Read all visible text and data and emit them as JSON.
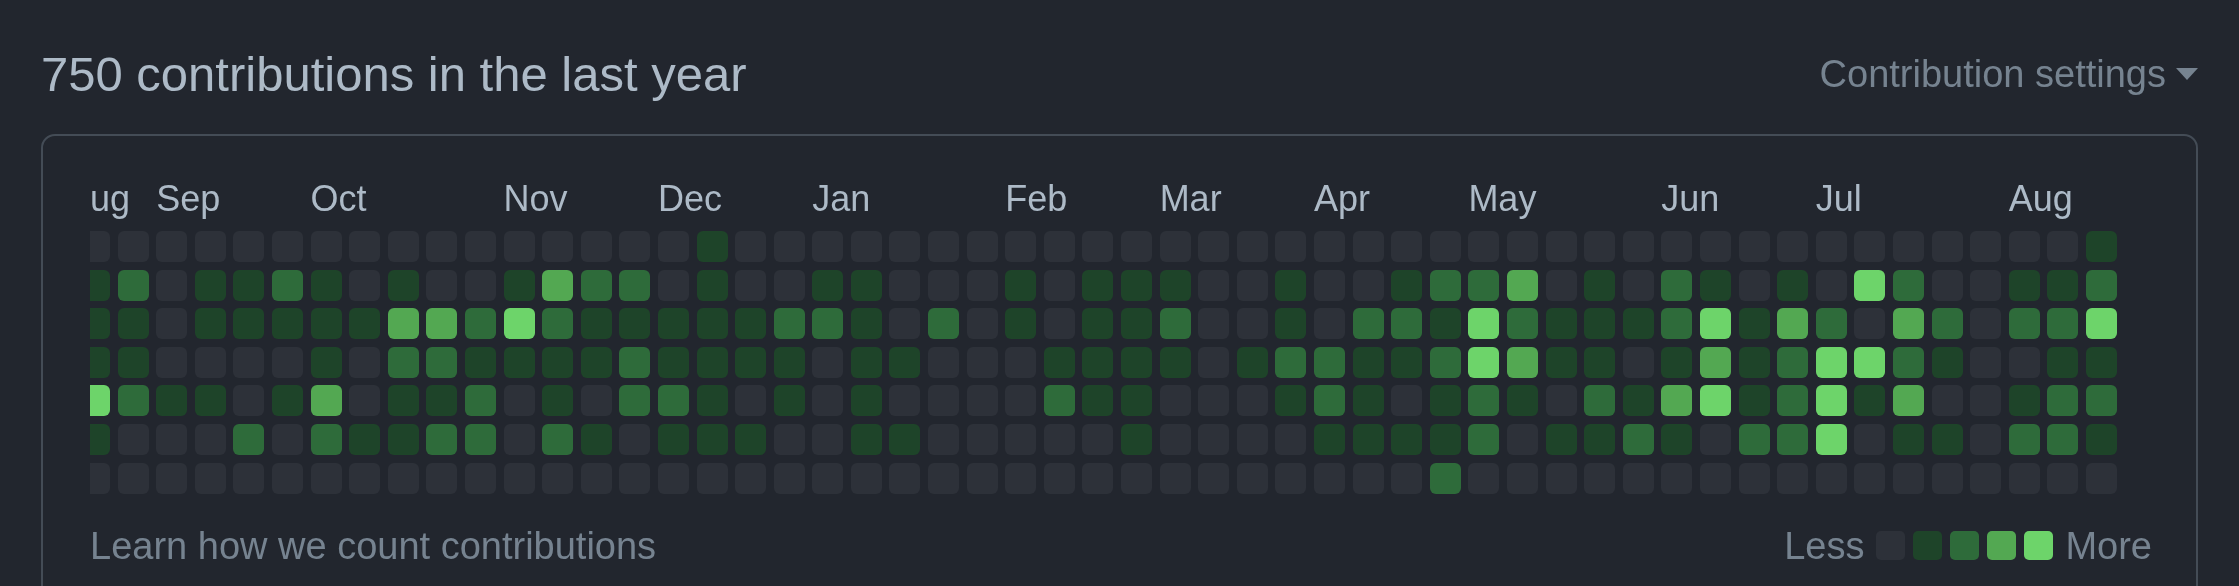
{
  "title": "750 contributions in the last year",
  "settings": {
    "label": "Contribution settings"
  },
  "weeks": [
    {
      "month": "ug",
      "days": [
        {
          "color": "#2d3139"
        },
        {
          "color": "#1e4429"
        },
        {
          "color": "#1e4429"
        },
        {
          "color": "#1e4429"
        },
        {
          "color": "#6dd46a"
        },
        {
          "color": "#1e4429"
        },
        {
          "color": "#2d3139"
        }
      ]
    },
    {
      "days": [
        {
          "color": "#2d3139"
        },
        {
          "color": "#2e6b3a"
        },
        {
          "color": "#1e4429"
        },
        {
          "color": "#1e4429"
        },
        {
          "color": "#2e6b3a"
        },
        {
          "color": "#2d3139"
        },
        {
          "color": "#2d3139"
        }
      ]
    },
    {
      "month": "Sep",
      "days": [
        {
          "color": "#2d3139"
        },
        {
          "color": "#2d3139"
        },
        {
          "color": "#2d3139"
        },
        {
          "color": "#2d3139"
        },
        {
          "color": "#1e4429"
        },
        {
          "color": "#2d3139"
        },
        {
          "color": "#2d3139"
        }
      ]
    },
    {
      "days": [
        {
          "color": "#2d3139"
        },
        {
          "color": "#1e4429"
        },
        {
          "color": "#1e4429"
        },
        {
          "color": "#2d3139"
        },
        {
          "color": "#1e4429"
        },
        {
          "color": "#2d3139"
        },
        {
          "color": "#2d3139"
        }
      ]
    },
    {
      "days": [
        {
          "color": "#2d3139"
        },
        {
          "color": "#1e4429"
        },
        {
          "color": "#1e4429"
        },
        {
          "color": "#2d3139"
        },
        {
          "color": "#2d3139"
        },
        {
          "color": "#2e6b3a"
        },
        {
          "color": "#2d3139"
        }
      ]
    },
    {
      "days": [
        {
          "color": "#2d3139"
        },
        {
          "color": "#2e6b3a"
        },
        {
          "color": "#1e4429"
        },
        {
          "color": "#2d3139"
        },
        {
          "color": "#1e4429"
        },
        {
          "color": "#2d3139"
        },
        {
          "color": "#2d3139"
        }
      ]
    },
    {
      "month": "Oct",
      "days": [
        {
          "color": "#2d3139"
        },
        {
          "color": "#1e4429"
        },
        {
          "color": "#1e4429"
        },
        {
          "color": "#1e4429"
        },
        {
          "color": "#53a852"
        },
        {
          "color": "#2e6b3a"
        },
        {
          "color": "#2d3139"
        }
      ]
    },
    {
      "days": [
        {
          "color": "#2d3139"
        },
        {
          "color": "#2d3139"
        },
        {
          "color": "#1e4429"
        },
        {
          "color": "#2d3139"
        },
        {
          "color": "#2d3139"
        },
        {
          "color": "#1e4429"
        },
        {
          "color": "#2d3139"
        }
      ]
    },
    {
      "days": [
        {
          "color": "#2d3139"
        },
        {
          "color": "#1e4429"
        },
        {
          "color": "#53a852"
        },
        {
          "color": "#2e6b3a"
        },
        {
          "color": "#1e4429"
        },
        {
          "color": "#1e4429"
        },
        {
          "color": "#2d3139"
        }
      ]
    },
    {
      "days": [
        {
          "color": "#2d3139"
        },
        {
          "color": "#2d3139"
        },
        {
          "color": "#53a852"
        },
        {
          "color": "#2e6b3a"
        },
        {
          "color": "#1e4429"
        },
        {
          "color": "#2e6b3a"
        },
        {
          "color": "#2d3139"
        }
      ]
    },
    {
      "days": [
        {
          "color": "#2d3139"
        },
        {
          "color": "#2d3139"
        },
        {
          "color": "#2e6b3a"
        },
        {
          "color": "#1e4429"
        },
        {
          "color": "#2e6b3a"
        },
        {
          "color": "#2e6b3a"
        },
        {
          "color": "#2d3139"
        }
      ]
    },
    {
      "month": "Nov",
      "days": [
        {
          "color": "#2d3139"
        },
        {
          "color": "#1e4429"
        },
        {
          "color": "#6dd46a"
        },
        {
          "color": "#1e4429"
        },
        {
          "color": "#2d3139"
        },
        {
          "color": "#2d3139"
        },
        {
          "color": "#2d3139"
        }
      ]
    },
    {
      "days": [
        {
          "color": "#2d3139"
        },
        {
          "color": "#53a852"
        },
        {
          "color": "#2e6b3a"
        },
        {
          "color": "#1e4429"
        },
        {
          "color": "#1e4429"
        },
        {
          "color": "#2e6b3a"
        },
        {
          "color": "#2d3139"
        }
      ]
    },
    {
      "days": [
        {
          "color": "#2d3139"
        },
        {
          "color": "#2e6b3a"
        },
        {
          "color": "#1e4429"
        },
        {
          "color": "#1e4429"
        },
        {
          "color": "#2d3139"
        },
        {
          "color": "#1e4429"
        },
        {
          "color": "#2d3139"
        }
      ]
    },
    {
      "days": [
        {
          "color": "#2d3139"
        },
        {
          "color": "#2e6b3a"
        },
        {
          "color": "#1e4429"
        },
        {
          "color": "#2e6b3a"
        },
        {
          "color": "#2e6b3a"
        },
        {
          "color": "#2d3139"
        },
        {
          "color": "#2d3139"
        }
      ]
    },
    {
      "month": "Dec",
      "days": [
        {
          "color": "#2d3139"
        },
        {
          "color": "#2d3139"
        },
        {
          "color": "#1e4429"
        },
        {
          "color": "#1e4429"
        },
        {
          "color": "#2e6b3a"
        },
        {
          "color": "#1e4429"
        },
        {
          "color": "#2d3139"
        }
      ]
    },
    {
      "days": [
        {
          "color": "#1e4429"
        },
        {
          "color": "#1e4429"
        },
        {
          "color": "#1e4429"
        },
        {
          "color": "#1e4429"
        },
        {
          "color": "#1e4429"
        },
        {
          "color": "#1e4429"
        },
        {
          "color": "#2d3139"
        }
      ]
    },
    {
      "days": [
        {
          "color": "#2d3139"
        },
        {
          "color": "#2d3139"
        },
        {
          "color": "#1e4429"
        },
        {
          "color": "#1e4429"
        },
        {
          "color": "#2d3139"
        },
        {
          "color": "#1e4429"
        },
        {
          "color": "#2d3139"
        }
      ]
    },
    {
      "days": [
        {
          "color": "#2d3139"
        },
        {
          "color": "#2d3139"
        },
        {
          "color": "#2e6b3a"
        },
        {
          "color": "#1e4429"
        },
        {
          "color": "#1e4429"
        },
        {
          "color": "#2d3139"
        },
        {
          "color": "#2d3139"
        }
      ]
    },
    {
      "month": "Jan",
      "days": [
        {
          "color": "#2d3139"
        },
        {
          "color": "#1e4429"
        },
        {
          "color": "#2e6b3a"
        },
        {
          "color": "#2d3139"
        },
        {
          "color": "#2d3139"
        },
        {
          "color": "#2d3139"
        },
        {
          "color": "#2d3139"
        }
      ]
    },
    {
      "days": [
        {
          "color": "#2d3139"
        },
        {
          "color": "#1e4429"
        },
        {
          "color": "#1e4429"
        },
        {
          "color": "#1e4429"
        },
        {
          "color": "#1e4429"
        },
        {
          "color": "#1e4429"
        },
        {
          "color": "#2d3139"
        }
      ]
    },
    {
      "days": [
        {
          "color": "#2d3139"
        },
        {
          "color": "#2d3139"
        },
        {
          "color": "#2d3139"
        },
        {
          "color": "#1e4429"
        },
        {
          "color": "#2d3139"
        },
        {
          "color": "#1e4429"
        },
        {
          "color": "#2d3139"
        }
      ]
    },
    {
      "days": [
        {
          "color": "#2d3139"
        },
        {
          "color": "#2d3139"
        },
        {
          "color": "#2e6b3a"
        },
        {
          "color": "#2d3139"
        },
        {
          "color": "#2d3139"
        },
        {
          "color": "#2d3139"
        },
        {
          "color": "#2d3139"
        }
      ]
    },
    {
      "days": [
        {
          "color": "#2d3139"
        },
        {
          "color": "#2d3139"
        },
        {
          "color": "#2d3139"
        },
        {
          "color": "#2d3139"
        },
        {
          "color": "#2d3139"
        },
        {
          "color": "#2d3139"
        },
        {
          "color": "#2d3139"
        }
      ]
    },
    {
      "month": "Feb",
      "days": [
        {
          "color": "#2d3139"
        },
        {
          "color": "#1e4429"
        },
        {
          "color": "#1e4429"
        },
        {
          "color": "#2d3139"
        },
        {
          "color": "#2d3139"
        },
        {
          "color": "#2d3139"
        },
        {
          "color": "#2d3139"
        }
      ]
    },
    {
      "days": [
        {
          "color": "#2d3139"
        },
        {
          "color": "#2d3139"
        },
        {
          "color": "#2d3139"
        },
        {
          "color": "#1e4429"
        },
        {
          "color": "#2e6b3a"
        },
        {
          "color": "#2d3139"
        },
        {
          "color": "#2d3139"
        }
      ]
    },
    {
      "days": [
        {
          "color": "#2d3139"
        },
        {
          "color": "#1e4429"
        },
        {
          "color": "#1e4429"
        },
        {
          "color": "#1e4429"
        },
        {
          "color": "#1e4429"
        },
        {
          "color": "#2d3139"
        },
        {
          "color": "#2d3139"
        }
      ]
    },
    {
      "days": [
        {
          "color": "#2d3139"
        },
        {
          "color": "#1e4429"
        },
        {
          "color": "#1e4429"
        },
        {
          "color": "#1e4429"
        },
        {
          "color": "#1e4429"
        },
        {
          "color": "#1e4429"
        },
        {
          "color": "#2d3139"
        }
      ]
    },
    {
      "month": "Mar",
      "days": [
        {
          "color": "#2d3139"
        },
        {
          "color": "#1e4429"
        },
        {
          "color": "#2e6b3a"
        },
        {
          "color": "#1e4429"
        },
        {
          "color": "#2d3139"
        },
        {
          "color": "#2d3139"
        },
        {
          "color": "#2d3139"
        }
      ]
    },
    {
      "days": [
        {
          "color": "#2d3139"
        },
        {
          "color": "#2d3139"
        },
        {
          "color": "#2d3139"
        },
        {
          "color": "#2d3139"
        },
        {
          "color": "#2d3139"
        },
        {
          "color": "#2d3139"
        },
        {
          "color": "#2d3139"
        }
      ]
    },
    {
      "days": [
        {
          "color": "#2d3139"
        },
        {
          "color": "#2d3139"
        },
        {
          "color": "#2d3139"
        },
        {
          "color": "#1e4429"
        },
        {
          "color": "#2d3139"
        },
        {
          "color": "#2d3139"
        },
        {
          "color": "#2d3139"
        }
      ]
    },
    {
      "days": [
        {
          "color": "#2d3139"
        },
        {
          "color": "#1e4429"
        },
        {
          "color": "#1e4429"
        },
        {
          "color": "#2e6b3a"
        },
        {
          "color": "#1e4429"
        },
        {
          "color": "#2d3139"
        },
        {
          "color": "#2d3139"
        }
      ]
    },
    {
      "month": "Apr",
      "days": [
        {
          "color": "#2d3139"
        },
        {
          "color": "#2d3139"
        },
        {
          "color": "#2d3139"
        },
        {
          "color": "#2e6b3a"
        },
        {
          "color": "#2e6b3a"
        },
        {
          "color": "#1e4429"
        },
        {
          "color": "#2d3139"
        }
      ]
    },
    {
      "days": [
        {
          "color": "#2d3139"
        },
        {
          "color": "#2d3139"
        },
        {
          "color": "#2e6b3a"
        },
        {
          "color": "#1e4429"
        },
        {
          "color": "#1e4429"
        },
        {
          "color": "#1e4429"
        },
        {
          "color": "#2d3139"
        }
      ]
    },
    {
      "days": [
        {
          "color": "#2d3139"
        },
        {
          "color": "#1e4429"
        },
        {
          "color": "#2e6b3a"
        },
        {
          "color": "#1e4429"
        },
        {
          "color": "#2d3139"
        },
        {
          "color": "#1e4429"
        },
        {
          "color": "#2d3139"
        }
      ]
    },
    {
      "days": [
        {
          "color": "#2d3139"
        },
        {
          "color": "#2e6b3a"
        },
        {
          "color": "#1e4429"
        },
        {
          "color": "#2e6b3a"
        },
        {
          "color": "#1e4429"
        },
        {
          "color": "#1e4429"
        },
        {
          "color": "#2e6b3a"
        }
      ]
    },
    {
      "month": "May",
      "days": [
        {
          "color": "#2d3139"
        },
        {
          "color": "#2e6b3a"
        },
        {
          "color": "#6dd46a"
        },
        {
          "color": "#6dd46a"
        },
        {
          "color": "#2e6b3a"
        },
        {
          "color": "#2e6b3a"
        },
        {
          "color": "#2d3139"
        }
      ]
    },
    {
      "days": [
        {
          "color": "#2d3139"
        },
        {
          "color": "#53a852"
        },
        {
          "color": "#2e6b3a"
        },
        {
          "color": "#53a852"
        },
        {
          "color": "#1e4429"
        },
        {
          "color": "#2d3139"
        },
        {
          "color": "#2d3139"
        }
      ]
    },
    {
      "days": [
        {
          "color": "#2d3139"
        },
        {
          "color": "#2d3139"
        },
        {
          "color": "#1e4429"
        },
        {
          "color": "#1e4429"
        },
        {
          "color": "#2d3139"
        },
        {
          "color": "#1e4429"
        },
        {
          "color": "#2d3139"
        }
      ]
    },
    {
      "days": [
        {
          "color": "#2d3139"
        },
        {
          "color": "#1e4429"
        },
        {
          "color": "#1e4429"
        },
        {
          "color": "#1e4429"
        },
        {
          "color": "#2e6b3a"
        },
        {
          "color": "#1e4429"
        },
        {
          "color": "#2d3139"
        }
      ]
    },
    {
      "days": [
        {
          "color": "#2d3139"
        },
        {
          "color": "#2d3139"
        },
        {
          "color": "#1e4429"
        },
        {
          "color": "#2d3139"
        },
        {
          "color": "#1e4429"
        },
        {
          "color": "#2e6b3a"
        },
        {
          "color": "#2d3139"
        }
      ]
    },
    {
      "month": "Jun",
      "days": [
        {
          "color": "#2d3139"
        },
        {
          "color": "#2e6b3a"
        },
        {
          "color": "#2e6b3a"
        },
        {
          "color": "#1e4429"
        },
        {
          "color": "#53a852"
        },
        {
          "color": "#1e4429"
        },
        {
          "color": "#2d3139"
        }
      ]
    },
    {
      "days": [
        {
          "color": "#2d3139"
        },
        {
          "color": "#1e4429"
        },
        {
          "color": "#6dd46a"
        },
        {
          "color": "#53a852"
        },
        {
          "color": "#6dd46a"
        },
        {
          "color": "#2d3139"
        },
        {
          "color": "#2d3139"
        }
      ]
    },
    {
      "days": [
        {
          "color": "#2d3139"
        },
        {
          "color": "#2d3139"
        },
        {
          "color": "#1e4429"
        },
        {
          "color": "#1e4429"
        },
        {
          "color": "#1e4429"
        },
        {
          "color": "#2e6b3a"
        },
        {
          "color": "#2d3139"
        }
      ]
    },
    {
      "days": [
        {
          "color": "#2d3139"
        },
        {
          "color": "#1e4429"
        },
        {
          "color": "#53a852"
        },
        {
          "color": "#2e6b3a"
        },
        {
          "color": "#2e6b3a"
        },
        {
          "color": "#2e6b3a"
        },
        {
          "color": "#2d3139"
        }
      ]
    },
    {
      "month": "Jul",
      "days": [
        {
          "color": "#2d3139"
        },
        {
          "color": "#2d3139"
        },
        {
          "color": "#2e6b3a"
        },
        {
          "color": "#6dd46a"
        },
        {
          "color": "#6dd46a"
        },
        {
          "color": "#6dd46a"
        },
        {
          "color": "#2d3139"
        }
      ]
    },
    {
      "days": [
        {
          "color": "#2d3139"
        },
        {
          "color": "#6dd46a"
        },
        {
          "color": "#2d3139"
        },
        {
          "color": "#6dd46a"
        },
        {
          "color": "#1e4429"
        },
        {
          "color": "#2d3139"
        },
        {
          "color": "#2d3139"
        }
      ]
    },
    {
      "days": [
        {
          "color": "#2d3139"
        },
        {
          "color": "#2e6b3a"
        },
        {
          "color": "#53a852"
        },
        {
          "color": "#2e6b3a"
        },
        {
          "color": "#53a852"
        },
        {
          "color": "#1e4429"
        },
        {
          "color": "#2d3139"
        }
      ]
    },
    {
      "days": [
        {
          "color": "#2d3139"
        },
        {
          "color": "#2d3139"
        },
        {
          "color": "#2e6b3a"
        },
        {
          "color": "#1e4429"
        },
        {
          "color": "#2d3139"
        },
        {
          "color": "#1e4429"
        },
        {
          "color": "#2d3139"
        }
      ]
    },
    {
      "days": [
        {
          "color": "#2d3139"
        },
        {
          "color": "#2d3139"
        },
        {
          "color": "#2d3139"
        },
        {
          "color": "#2d3139"
        },
        {
          "color": "#2d3139"
        },
        {
          "color": "#2d3139"
        },
        {
          "color": "#2d3139"
        }
      ]
    },
    {
      "month": "Aug",
      "days": [
        {
          "color": "#2d3139"
        },
        {
          "color": "#1e4429"
        },
        {
          "color": "#2e6b3a"
        },
        {
          "color": "#2d3139"
        },
        {
          "color": "#1e4429"
        },
        {
          "color": "#2e6b3a"
        },
        {
          "color": "#2d3139"
        }
      ]
    },
    {
      "days": [
        {
          "color": "#2d3139"
        },
        {
          "color": "#1e4429"
        },
        {
          "color": "#2e6b3a"
        },
        {
          "color": "#1e4429"
        },
        {
          "color": "#2e6b3a"
        },
        {
          "color": "#2e6b3a"
        },
        {
          "color": "#2d3139"
        }
      ]
    },
    {
      "days": [
        {
          "color": "#1e4429"
        },
        {
          "color": "#2e6b3a"
        },
        {
          "color": "#6dd46a"
        },
        {
          "color": "#1e4429"
        },
        {
          "color": "#2e6b3a"
        },
        {
          "color": "#1e4429"
        },
        {
          "color": "#2d3139"
        }
      ]
    }
  ],
  "footer_link": "Learn how we count contributions",
  "legend": {
    "less": "Less",
    "more": "More",
    "swatches": [
      {
        "color": "#2d3139"
      },
      {
        "color": "#1e4429"
      },
      {
        "color": "#2e6b3a"
      },
      {
        "color": "#53a852"
      },
      {
        "color": "#6dd46a"
      }
    ]
  }
}
